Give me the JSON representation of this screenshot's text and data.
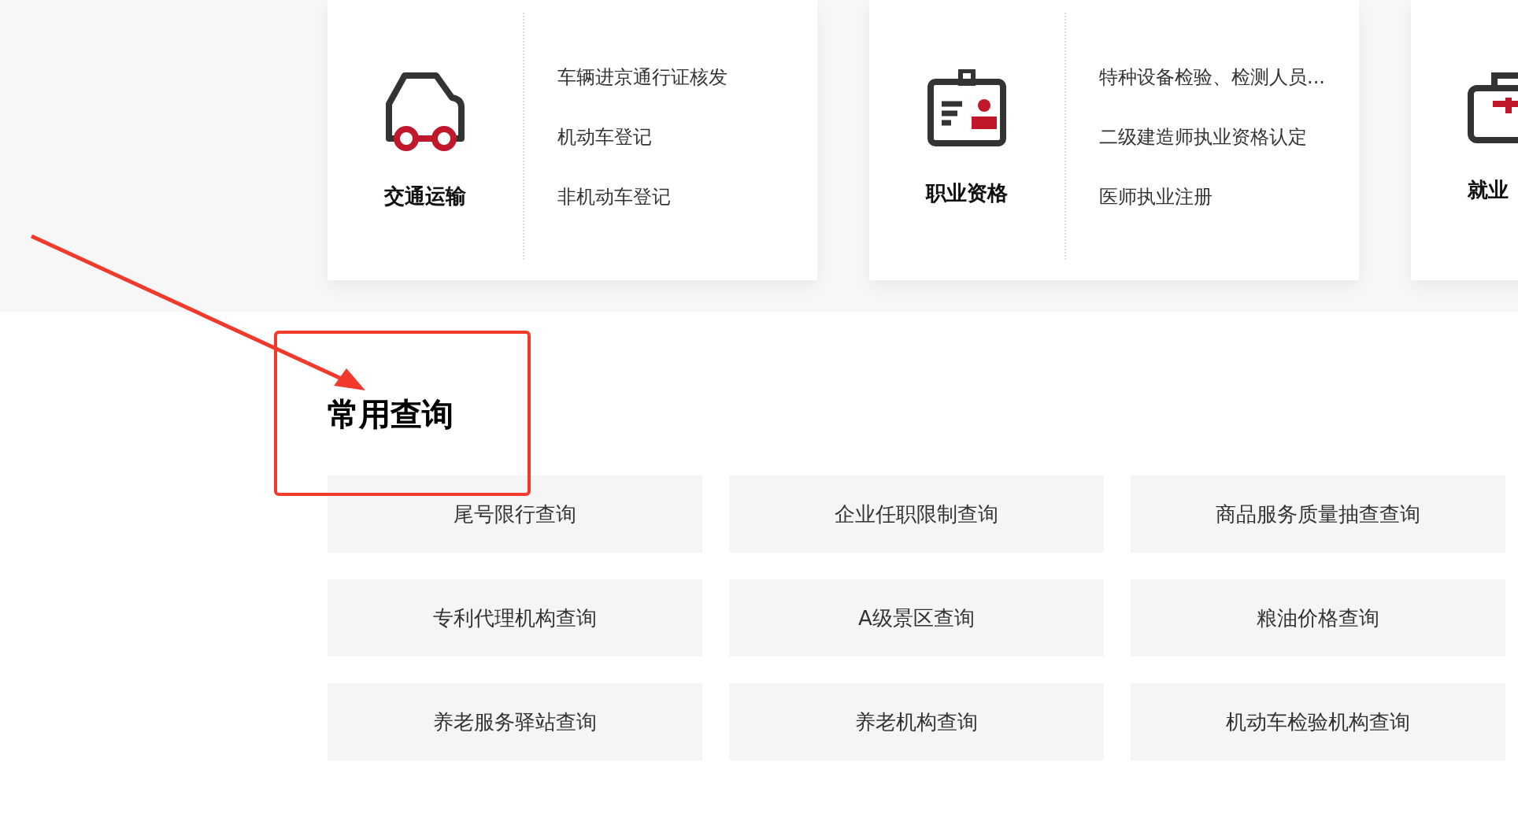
{
  "service_cards": [
    {
      "kind": "car",
      "title": "交通运输",
      "links": [
        "车辆进京通行证核发",
        "机动车登记",
        "非机动车登记"
      ]
    },
    {
      "kind": "badge",
      "title": "职业资格",
      "links": [
        "特种设备检验、检测人员...",
        "二级建造师执业资格认定",
        "医师执业注册"
      ]
    },
    {
      "kind": "briefcase",
      "title": "就业"
    }
  ],
  "common_queries": {
    "heading": "常用查询",
    "items": [
      "尾号限行查询",
      "企业任职限制查询",
      "商品服务质量抽查查询",
      "专利代理机构查询",
      "A级景区查询",
      "粮油价格查询",
      "养老服务驿站查询",
      "养老机构查询",
      "机动车检验机构查询"
    ]
  }
}
